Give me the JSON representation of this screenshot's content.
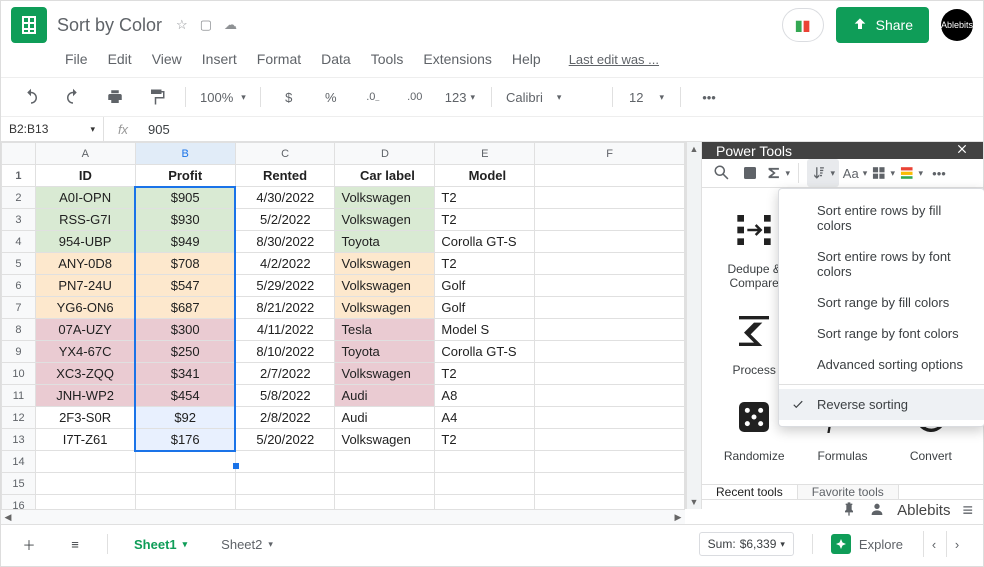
{
  "doc": {
    "title": "Sort by Color",
    "last_edit": "Last edit was ..."
  },
  "menus": [
    "File",
    "Edit",
    "View",
    "Insert",
    "Format",
    "Data",
    "Tools",
    "Extensions",
    "Help"
  ],
  "share": {
    "label": "Share",
    "avatar": "Ablebits"
  },
  "toolbar": {
    "zoom": "100%",
    "font": "Calibri",
    "size": "12"
  },
  "formula": {
    "namebox": "B2:B13",
    "fx": "fx",
    "value": "905"
  },
  "columns": [
    "",
    "A",
    "B",
    "C",
    "D",
    "E",
    "F"
  ],
  "headers": {
    "id": "ID",
    "profit": "Profit",
    "rented": "Rented",
    "label": "Car label",
    "model": "Model"
  },
  "rows": [
    {
      "n": 1
    },
    {
      "n": 2,
      "id": "A0I-OPN",
      "profit": "$905",
      "rented": "4/30/2022",
      "label": "Volkswagen",
      "model": "T2",
      "fill": "green"
    },
    {
      "n": 3,
      "id": "RSS-G7I",
      "profit": "$930",
      "rented": "5/2/2022",
      "label": "Volkswagen",
      "model": "T2",
      "fill": "green"
    },
    {
      "n": 4,
      "id": "954-UBP",
      "profit": "$949",
      "rented": "8/30/2022",
      "label": "Toyota",
      "model": "Corolla GT-S",
      "fill": "green"
    },
    {
      "n": 5,
      "id": "ANY-0D8",
      "profit": "$708",
      "rented": "4/2/2022",
      "label": "Volkswagen",
      "model": "T2",
      "fill": "amber"
    },
    {
      "n": 6,
      "id": "PN7-24U",
      "profit": "$547",
      "rented": "5/29/2022",
      "label": "Volkswagen",
      "model": "Golf",
      "fill": "amber"
    },
    {
      "n": 7,
      "id": "YG6-ON6",
      "profit": "$687",
      "rented": "8/21/2022",
      "label": "Volkswagen",
      "model": "Golf",
      "fill": "amber"
    },
    {
      "n": 8,
      "id": "07A-UZY",
      "profit": "$300",
      "rented": "4/11/2022",
      "label": "Tesla",
      "model": "Model S",
      "fill": "rose"
    },
    {
      "n": 9,
      "id": "YX4-67C",
      "profit": "$250",
      "rented": "8/10/2022",
      "label": "Toyota",
      "model": "Corolla GT-S",
      "fill": "rose"
    },
    {
      "n": 10,
      "id": "XC3-ZQQ",
      "profit": "$341",
      "rented": "2/7/2022",
      "label": "Volkswagen",
      "model": "T2",
      "fill": "rose"
    },
    {
      "n": 11,
      "id": "JNH-WP2",
      "profit": "$454",
      "rented": "5/8/2022",
      "label": "Audi",
      "model": "A8",
      "fill": "rose"
    },
    {
      "n": 12,
      "id": "2F3-S0R",
      "profit": "$92",
      "rented": "2/8/2022",
      "label": "Audi",
      "model": "A4",
      "fill": ""
    },
    {
      "n": 13,
      "id": "I7T-Z61",
      "profit": "$176",
      "rented": "5/20/2022",
      "label": "Volkswagen",
      "model": "T2",
      "fill": ""
    },
    {
      "n": 14
    },
    {
      "n": 15
    },
    {
      "n": 16
    }
  ],
  "panel": {
    "title": "Power Tools",
    "cards": [
      {
        "k": "dedupe",
        "label": "Dedupe &\nCompare"
      },
      {
        "k": "process",
        "label": "Process"
      },
      {
        "k": "randomize",
        "label": "Randomize"
      },
      {
        "k": "formulas",
        "label": "Formulas"
      },
      {
        "k": "convert",
        "label": "Convert"
      }
    ],
    "menu": [
      {
        "label": "Sort entire rows by fill colors"
      },
      {
        "label": "Sort entire rows by font colors"
      },
      {
        "label": "Sort range by fill colors"
      },
      {
        "label": "Sort range by font colors"
      },
      {
        "label": "Advanced sorting options"
      },
      {
        "label": "Reverse sorting",
        "checked": true
      }
    ],
    "tabs": {
      "recent": "Recent tools",
      "favorite": "Favorite tools"
    },
    "brand": "Ablebits"
  },
  "sheets": {
    "s1": "Sheet1",
    "s2": "Sheet2"
  },
  "stats": {
    "sum_label": "Sum:",
    "sum": "$6,339"
  },
  "explore": "Explore"
}
